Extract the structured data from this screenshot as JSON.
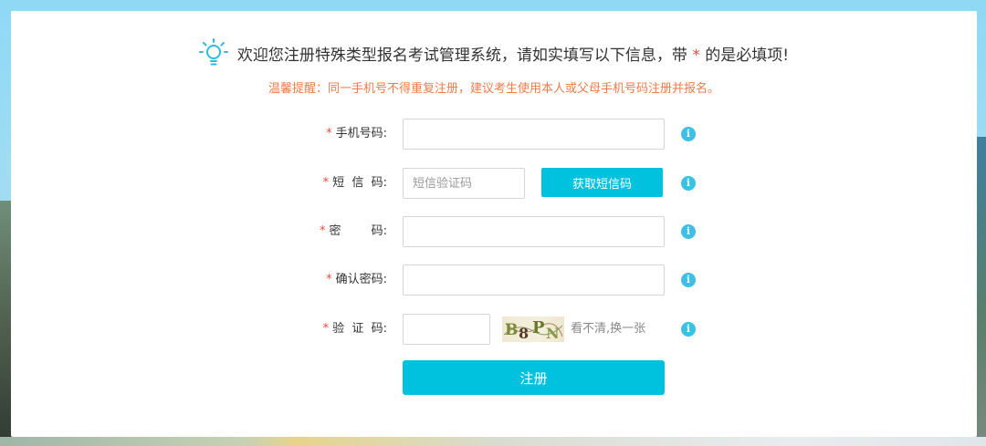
{
  "header": {
    "welcome_prefix": "欢迎您注册特殊类型报名考试管理系统，请如实填写以下信息，带",
    "required_mark": "*",
    "welcome_suffix": "的是必填项!",
    "tip": "温馨提醒：同一手机号不得重复注册，建议考生使用本人或父母手机号码注册并报名。"
  },
  "form": {
    "required_mark": "*",
    "phone": {
      "label": "手机号码:",
      "value": ""
    },
    "sms": {
      "label": "短  信  码:",
      "value": "",
      "placeholder": "短信验证码",
      "button_label": "获取短信码"
    },
    "password": {
      "label": "密        码:",
      "value": ""
    },
    "confirm_password": {
      "label": "确认密码:",
      "value": ""
    },
    "captcha": {
      "label": "验  证  码:",
      "value": "",
      "image_text": "B8PN",
      "refresh_label": "看不清,换一张"
    },
    "info_glyph": "i",
    "submit_label": "注册"
  },
  "colors": {
    "accent": "#00c1de",
    "required": "#e84b3c",
    "tip": "#ee7b4a",
    "info_icon": "#3dbfe6"
  },
  "icons": {
    "header": "lightbulb-icon",
    "field_hint": "info-icon"
  }
}
